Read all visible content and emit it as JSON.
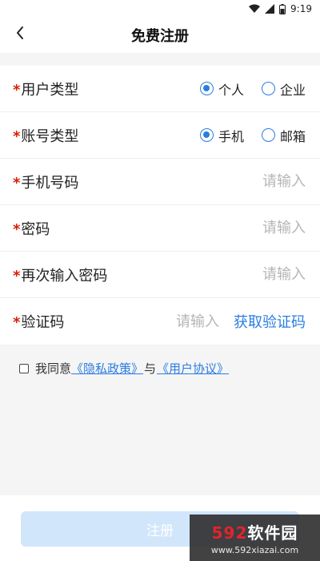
{
  "status_bar": {
    "time": "9:19"
  },
  "header": {
    "title": "免费注册"
  },
  "form": {
    "required_mark": "*",
    "user_type": {
      "label": "用户类型",
      "options": [
        "个人",
        "企业"
      ],
      "selected": "个人"
    },
    "account_type": {
      "label": "账号类型",
      "options": [
        "手机",
        "邮箱"
      ],
      "selected": "手机"
    },
    "phone": {
      "label": "手机号码",
      "placeholder": "请输入"
    },
    "password": {
      "label": "密码",
      "placeholder": "请输入"
    },
    "password_confirm": {
      "label": "再次输入密码",
      "placeholder": "请输入"
    },
    "code": {
      "label": "验证码",
      "placeholder": "请输入",
      "get_code_label": "获取验证码"
    }
  },
  "agreement": {
    "prefix": "我同意",
    "privacy_link": "《隐私政策》",
    "conjunction": "与",
    "terms_link": "《用户协议》"
  },
  "register_button": {
    "label": "注册"
  },
  "watermark": {
    "num": "592",
    "cn": "软件园",
    "url": "www.592xiazai.com"
  },
  "colors": {
    "accent": "#2a7de1",
    "required": "#d81e06",
    "button_disabled": "#d2e6fb"
  },
  "icons": [
    "wifi-icon",
    "signal-icon",
    "battery-icon",
    "back-arrow-icon",
    "radio-checked-icon",
    "radio-unchecked-icon",
    "checkbox-icon"
  ]
}
